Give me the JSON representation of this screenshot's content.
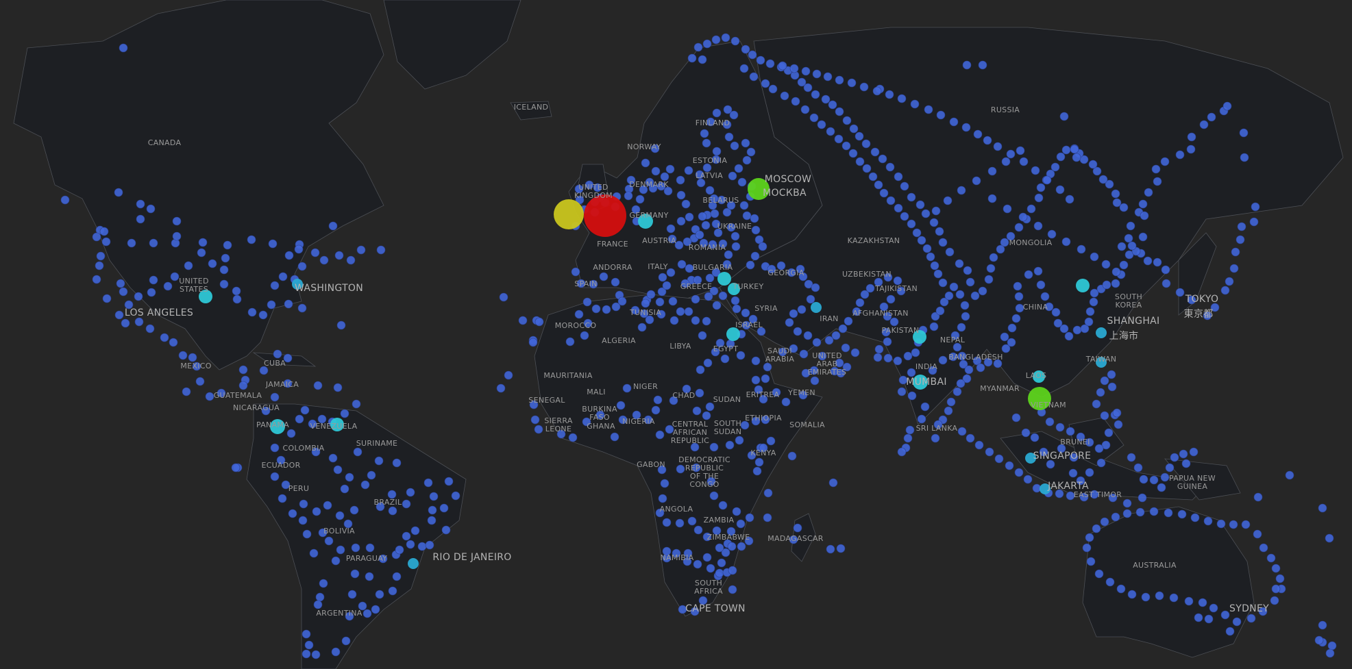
{
  "map": {
    "colors": {
      "ocean": "#262626",
      "land": "#1e2024",
      "border": "#5a5d63",
      "dot_default": "#4166d8",
      "dot_cyan": "#2ec7d6",
      "dot_teal": "#2aa9d2",
      "dot_green": "#5dd31c",
      "dot_yellow": "#c9c51e",
      "dot_red": "#d40f0f",
      "label": "#9a9a9a"
    },
    "country_labels": [
      "ICELAND",
      "CANADA",
      "FINLAND",
      "NORWAY",
      "ESTONIA",
      "LATVIA",
      "DENMARK",
      "UNITED KINGDOM",
      "BELARUS",
      "GERMANY",
      "UKRAINE",
      "FRANCE",
      "AUSTRIA",
      "ROMANIA",
      "ANDORRA",
      "ITALY",
      "BULGARIA",
      "SPAIN",
      "GREECE",
      "TURKEY",
      "GEORGIA",
      "MOROCCO",
      "TUNISIA",
      "SYRIA",
      "ISRAEL",
      "ALGERIA",
      "LIBYA",
      "EGYPT",
      "SAUDI ARABIA",
      "UNITED ARAB EMIRATES",
      "IRAN",
      "MAURITANIA",
      "MALI",
      "NIGER",
      "CHAD",
      "SUDAN",
      "ERITREA",
      "YEMEN",
      "SENEGAL",
      "BURKINA FASO",
      "NIGERIA",
      "SIERRA LEONE",
      "GHANA",
      "CENTRAL AFRICAN REPUBLIC",
      "SOUTH SUDAN",
      "ETHIOPIA",
      "SOMALIA",
      "KENYA",
      "GABON",
      "DEMOCRATIC REPUBLIC OF THE CONGO",
      "ANGOLA",
      "ZAMBIA",
      "ZIMBABWE",
      "NAMIBIA",
      "MADAGASCAR",
      "SOUTH AFRICA",
      "RUSSIA",
      "KAZAKHSTAN",
      "UZBEKISTAN",
      "TAJIKISTAN",
      "AFGHANISTAN",
      "PAKISTAN",
      "NEPAL",
      "INDIA",
      "BANGLADESH",
      "MONGOLIA",
      "CHINA",
      "SOUTH KOREA",
      "MYANMAR",
      "LAOS",
      "VIETNAM",
      "TAIWAN",
      "SRI LANKA",
      "BRUNEI",
      "EAST TIMOR",
      "PAPUA NEW GUINEA",
      "AUSTRALIA",
      "UNITED STATES",
      "MEXICO",
      "CUBA",
      "JAMAICA",
      "GUATEMALA",
      "NICARAGUA",
      "PANAMA",
      "VENEZUELA",
      "COLOMBIA",
      "ECUADOR",
      "SURINAME",
      "PERU",
      "BRAZIL",
      "BOLIVIA",
      "PARAGUAY",
      "ARGENTINA"
    ],
    "city_labels": [
      "MOSCOW",
      "МОСКВА",
      "WASHINGTON",
      "LOS ANGELES",
      "MUMBAI",
      "SINGAPORE",
      "JAKARTA",
      "SHANGHAI",
      "上海市",
      "TOKYO",
      "東京都",
      "RIO DE JANEIRO",
      "CAPE TOWN",
      "SYDNEY"
    ],
    "highlight_markers": [
      {
        "near": "UNITED KINGDOM",
        "color": "red",
        "size": "largest"
      },
      {
        "near": "UNITED KINGDOM",
        "color": "yellow",
        "size": "large"
      },
      {
        "near": "MOSCOW",
        "color": "green",
        "size": "medium"
      },
      {
        "near": "VIETNAM",
        "color": "green",
        "size": "medium"
      },
      {
        "near": "GERMANY",
        "color": "cyan",
        "size": "small"
      },
      {
        "near": "UNITED STATES",
        "color": "cyan",
        "size": "small"
      },
      {
        "near": "WASHINGTON",
        "color": "teal",
        "size": "small"
      },
      {
        "near": "PANAMA",
        "color": "cyan",
        "size": "small"
      },
      {
        "near": "VENEZUELA",
        "color": "cyan",
        "size": "small"
      },
      {
        "near": "BULGARIA",
        "color": "cyan",
        "size": "small"
      },
      {
        "near": "TURKEY",
        "color": "cyan",
        "size": "small"
      },
      {
        "near": "ISRAEL",
        "color": "cyan",
        "size": "small"
      },
      {
        "near": "IRAN",
        "color": "teal",
        "size": "small"
      },
      {
        "near": "PAKISTAN",
        "color": "cyan",
        "size": "small"
      },
      {
        "near": "MUMBAI",
        "color": "cyan",
        "size": "small"
      },
      {
        "near": "LAOS",
        "color": "cyan",
        "size": "small"
      },
      {
        "near": "CHINA",
        "color": "cyan",
        "size": "small"
      },
      {
        "near": "SHANGHAI",
        "color": "teal",
        "size": "small"
      },
      {
        "near": "TAIWAN",
        "color": "teal",
        "size": "small"
      },
      {
        "near": "SINGAPORE",
        "color": "teal",
        "size": "small"
      },
      {
        "near": "JAKARTA",
        "color": "teal",
        "size": "small"
      },
      {
        "near": "RIO DE JANEIRO",
        "color": "teal",
        "size": "small"
      }
    ]
  }
}
